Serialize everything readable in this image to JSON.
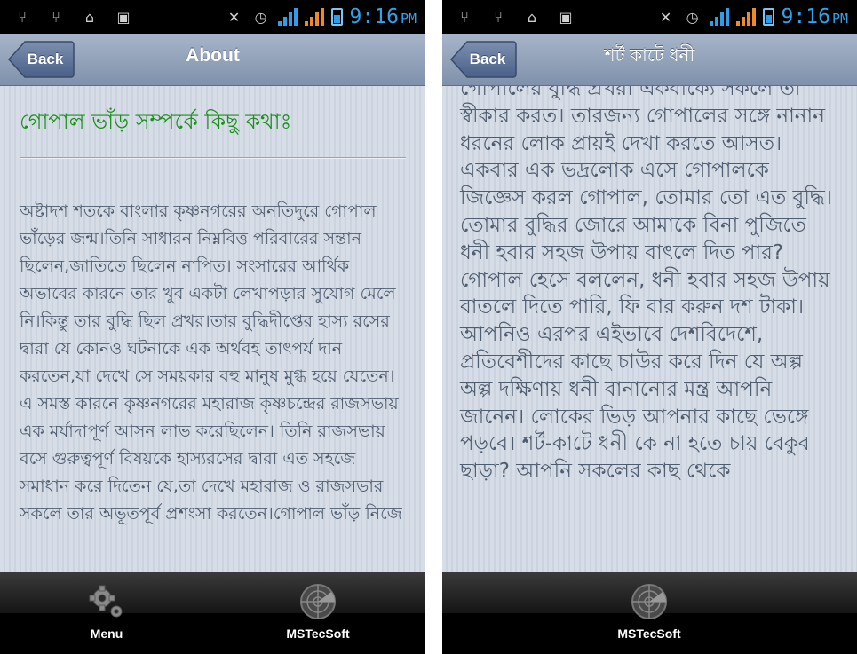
{
  "status_bar": {
    "time": "9:16",
    "ampm": "PM"
  },
  "screen_left": {
    "back_label": "Back",
    "title": "About",
    "heading": "গোপাল ভাঁড় সম্পর্কে কিছু কথাঃ",
    "body": "অষ্টাদশ শতকে বাংলার কৃষ্ণনগরের অনতিদুরে গোপাল ভাঁড়ের জন্ম।তিনি সাধারন নিম্নবিত্ত পরিবারের সন্তান ছিলেন,জাতিতে ছিলেন নাপিত। সংসারের আর্থিক অভাবের কারনে তার খুব একটা লেখাপড়ার সুযোগ মেলে নি।কিন্তু তার বুদ্ধি ছিল প্রখর।তার বুদ্ধিদীপ্তের হাস্য রসের দ্বারা যে কোনও ঘটনাকে এক অর্থবহ তাৎপর্য দান করতেন,যা দেখে সে সময়কার বহু মানুষ মুগ্ধ হয়ে যেতেন। এ সমস্ত কারনে কৃষ্ণনগরের মহারাজ কৃষ্ণচন্দ্রের রাজসভায় এক মর্যাদাপূর্ণ আসন লাভ করেছিলেন। তিনি রাজসভায় বসে গুরুত্বপূর্ণ বিষয়কে হাস্যরসের দ্বারা এত সহজে সমাধান করে দিতেন যে,তা দেখে মহারাজ ও রাজসভার সকলে তার অভূতপূর্ব প্রশংসা করতেন।গোপাল ভাঁড় নিজে",
    "tabs": [
      {
        "label": "Menu",
        "icon": "gears-icon"
      },
      {
        "label": "MSTecSoft",
        "icon": "radar-icon"
      }
    ]
  },
  "screen_right": {
    "back_label": "Back",
    "title": "শর্ট কাটে ধনী",
    "body": "গোপালের বুদ্ধি প্রখরা একবাক্যে সকলে তা স্বীকার করত। তারজন্য গোপালের সঙ্গে নানান ধরনের লোক প্রায়ই দেখা করতে আসত। একবার এক ভদ্রলোক এসে গোপালকে জিজ্ঞেস করল গোপাল, তোমার তো এত বুদ্ধি। তোমার বুদ্ধির জোরে আমাকে বিনা পুজিতে ধনী হবার সহজ উপায় বাৎলে দিত পার? গোপাল হেসে বললেন, ধনী হবার সহজ উপায় বাতলে দিতে পারি, ফি বার করুন দশ টাকা। আপনিও এরপর এইভাবে দেশবিদেশে, প্রতিবেশীদের কাছে চাউর করে দিন যে অল্প অল্প দক্ষিণায় ধনী বানানোর মন্ত্র আপনি জানেন। লোকের ভিড় আপনার কাছে ভেঙ্গে পড়বে। শর্ট-কাটে ধনী কে না হতে চায় বেকুব ছাড়া? আপনি সকলের কাছ থেকে",
    "tabs": [
      {
        "label": "MSTecSoft",
        "icon": "radar-icon"
      }
    ]
  },
  "colors": {
    "heading_green": "#1c8f1c",
    "body_text": "#4f5d70",
    "time_blue": "#31a2e8",
    "header_blue": "#8d9db4"
  }
}
